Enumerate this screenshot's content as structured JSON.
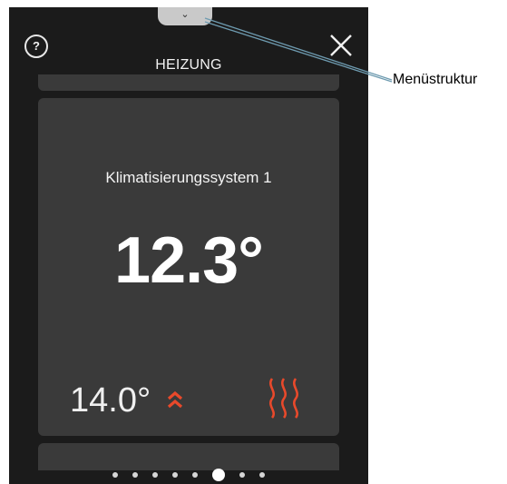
{
  "header": {
    "title": "HEIZUNG",
    "help_icon": "help-circle-icon",
    "help_symbol": "?",
    "close_icon": "close-icon",
    "menu_tab_icon": "chevron-down-icon",
    "menu_tab_symbol": "⌄"
  },
  "card": {
    "system_name": "Klimatisierungssystem 1",
    "current_temperature": "12.3°",
    "setpoint_temperature": "14.0°",
    "setpoint_icon": "double-chevron-up-icon",
    "heating_icon": "heat-waves-icon"
  },
  "pagination": {
    "total_pages": 8,
    "active_page": 6
  },
  "callout": {
    "label": "Menüstruktur"
  },
  "colors": {
    "screen_background": "#1b1b1b",
    "card_background": "#3a3a3a",
    "accent_red": "#e8492b"
  }
}
